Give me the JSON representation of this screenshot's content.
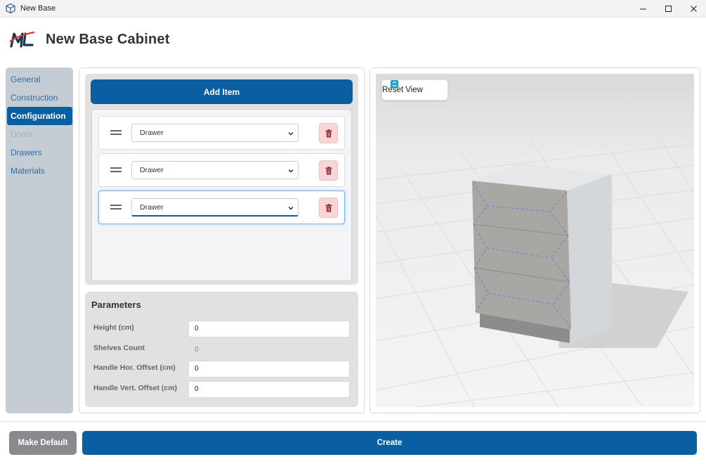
{
  "window": {
    "title": "New Base",
    "icon": "cube-icon",
    "minimize_glyph": "—",
    "maximize_glyph": "☐",
    "close_glyph": "✕"
  },
  "header": {
    "logo_text": "ML",
    "title": "New Base Cabinet"
  },
  "sidebar": {
    "items": [
      {
        "label": "General",
        "state": "normal"
      },
      {
        "label": "Construction",
        "state": "normal"
      },
      {
        "label": "Configuration",
        "state": "active"
      },
      {
        "label": "Doors",
        "state": "disabled"
      },
      {
        "label": "Drawers",
        "state": "normal"
      },
      {
        "label": "Materials",
        "state": "normal"
      }
    ]
  },
  "items_panel": {
    "add_label": "Add Item",
    "rows": [
      {
        "value": "Drawer",
        "selected": false
      },
      {
        "value": "Drawer",
        "selected": false
      },
      {
        "value": "Drawer",
        "selected": true
      }
    ]
  },
  "parameters": {
    "title": "Parameters",
    "height": {
      "label": "Height (cm)",
      "value": "0"
    },
    "shelves": {
      "label": "Shelves Count",
      "value": "0"
    },
    "handle_hor": {
      "label": "Handle Hor. Offset (cm)",
      "value": "0"
    },
    "handle_vert": {
      "label": "Handle Vert. Offset (cm)",
      "value": "0"
    }
  },
  "viewport": {
    "reset_label": "Reset View",
    "accent": "#1aa3c8"
  },
  "footer": {
    "make_default_label": "Make Default",
    "create_label": "Create"
  },
  "colors": {
    "primary": "#0a5fa3",
    "sidebar_bg": "#c6ccd3",
    "delete_bg": "#f8d6d7",
    "delete_icon": "#8b2a2e",
    "secondary_btn": "#8a8a8e"
  }
}
